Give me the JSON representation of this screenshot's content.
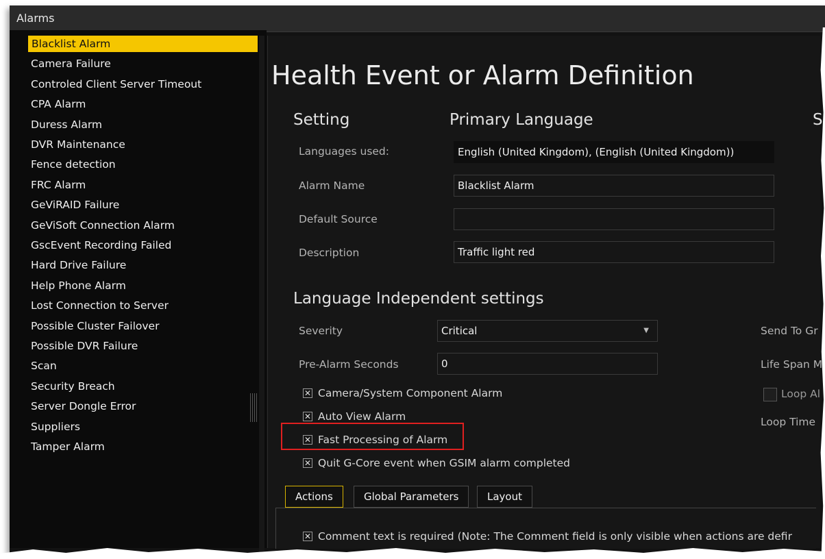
{
  "window": {
    "title": "Alarms"
  },
  "sidebar": {
    "items": [
      {
        "label": "Blacklist Alarm",
        "selected": true
      },
      {
        "label": "Camera Failure"
      },
      {
        "label": "Controled Client Server Timeout"
      },
      {
        "label": "CPA Alarm"
      },
      {
        "label": "Duress Alarm"
      },
      {
        "label": "DVR Maintenance"
      },
      {
        "label": "Fence detection"
      },
      {
        "label": "FRC Alarm"
      },
      {
        "label": "GeViRAID Failure"
      },
      {
        "label": "GeViSoft Connection Alarm"
      },
      {
        "label": "GscEvent Recording Failed"
      },
      {
        "label": "Hard Drive Failure"
      },
      {
        "label": "Help Phone Alarm"
      },
      {
        "label": "Lost Connection to Server"
      },
      {
        "label": "Possible Cluster Failover"
      },
      {
        "label": "Possible DVR Failure"
      },
      {
        "label": "Scan"
      },
      {
        "label": "Security Breach"
      },
      {
        "label": "Server Dongle Error"
      },
      {
        "label": "Suppliers"
      },
      {
        "label": "Tamper Alarm"
      }
    ]
  },
  "main": {
    "title": "Health Event or Alarm Definition",
    "col_setting": "Setting",
    "col_primary_language": "Primary Language",
    "col_right_partial": "S",
    "languages_used_label": "Languages used:",
    "languages_used_value": "English (United Kingdom), (English (United Kingdom))",
    "alarm_name_label": "Alarm Name",
    "alarm_name_value": "Blacklist Alarm",
    "default_source_label": "Default Source",
    "default_source_value": "",
    "description_label": "Description",
    "description_value": "Traffic light red",
    "lang_independent_title": "Language Independent settings",
    "severity_label": "Severity",
    "severity_value": "Critical",
    "prealarm_label": "Pre-Alarm Seconds",
    "prealarm_value": "0",
    "send_to_label": "Send To Gr",
    "life_span_label": "Life Span M",
    "loop_label": "Loop Al",
    "loop_time_label": "Loop Time",
    "checkboxes": {
      "camera_system": {
        "label": "Camera/System Component Alarm",
        "checked": true
      },
      "auto_view": {
        "label": "Auto View Alarm",
        "checked": true
      },
      "fast_processing": {
        "label": "Fast Processing of Alarm",
        "checked": true
      },
      "quit_gcore": {
        "label": "Quit G-Core event when GSIM alarm completed",
        "checked": true
      },
      "loop": {
        "checked": false
      }
    },
    "tabs": [
      {
        "label": "Actions",
        "active": true
      },
      {
        "label": "Global Parameters"
      },
      {
        "label": "Layout"
      }
    ],
    "comment_required": {
      "label": "Comment text is required (Note: The Comment field is only visible when actions are defir",
      "checked": true
    }
  },
  "colors": {
    "accent": "#f5c600",
    "highlight_border": "#e02020",
    "background": "#161616"
  }
}
